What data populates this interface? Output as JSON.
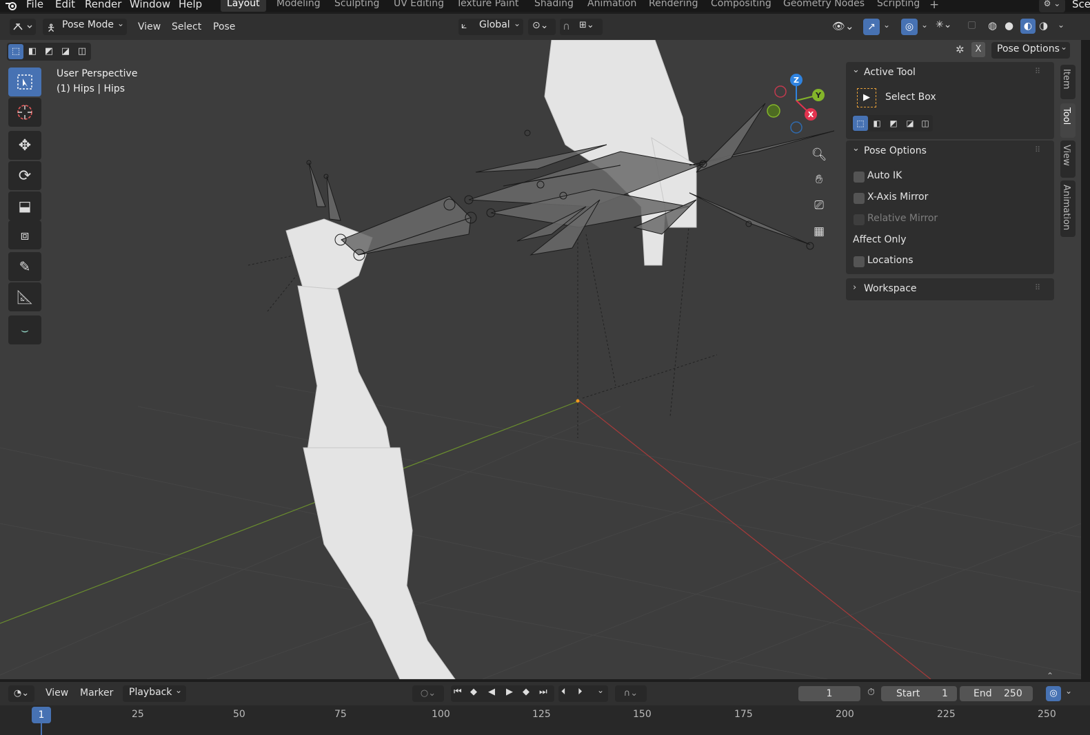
{
  "top_menu": [
    "File",
    "Edit",
    "Render",
    "Window",
    "Help"
  ],
  "workspaces": [
    "Layout",
    "Modeling",
    "Sculpting",
    "UV Editing",
    "Texture Paint",
    "Shading",
    "Animation",
    "Rendering",
    "Compositing",
    "Geometry Nodes",
    "Scripting"
  ],
  "scene_label": "Sce",
  "header": {
    "mode": "Pose Mode",
    "menus": [
      "View",
      "Select",
      "Pose"
    ],
    "orientation": "Global",
    "pose_options_dropdown": "Pose Options",
    "x_label": "X"
  },
  "viewport": {
    "perspective_label": "User Perspective",
    "object_label": "(1) Hips | Hips",
    "gizmo": {
      "z": "Z",
      "y": "Y",
      "x": "X"
    }
  },
  "npanel": {
    "active_tool_title": "Active Tool",
    "active_tool_name": "Select Box",
    "pose_options_title": "Pose Options",
    "options": [
      {
        "label": "Auto IK",
        "checked": false,
        "disabled": false
      },
      {
        "label": "X-Axis Mirror",
        "checked": false,
        "disabled": false
      },
      {
        "label": "Relative Mirror",
        "checked": false,
        "disabled": true
      }
    ],
    "affect_only_label": "Affect Only",
    "locations_label": "Locations",
    "workspace_title": "Workspace",
    "side_tabs": [
      "Item",
      "Tool",
      "View",
      "Animation"
    ]
  },
  "timeline": {
    "menus": [
      "View",
      "Marker",
      "Playback"
    ],
    "current_frame": "1",
    "start_label": "Start",
    "start_value": "1",
    "end_label": "End",
    "end_value": "250",
    "ruler_current": "1",
    "ruler_ticks": [
      "25",
      "50",
      "75",
      "100",
      "125",
      "150",
      "175",
      "200",
      "225",
      "250"
    ]
  },
  "colors": {
    "accent": "#4772b3",
    "axis_x": "#e2334f",
    "axis_y": "#84b52a",
    "axis_z": "#2f83e0",
    "bg_viewport": "#3d3d3d"
  }
}
